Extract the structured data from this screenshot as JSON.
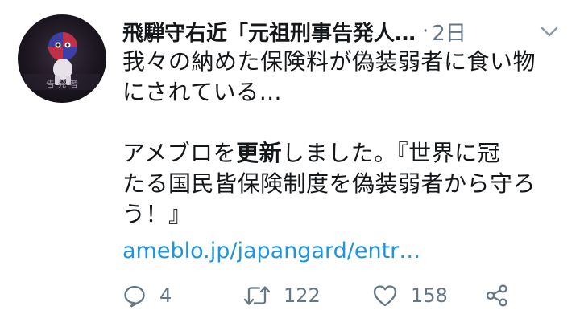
{
  "tweet": {
    "author_name": "飛騨守右近「元祖刑事告発人…",
    "separator": "·",
    "time": "2日",
    "line1": "我々の納めた保険料が偽装弱者に食い物",
    "line2": "にされている…",
    "line3_pre": "アメブロを",
    "line3_bold": "更新",
    "line3_post": "しました。『世界に冠",
    "line4": "たる国民皆保険制度を偽装弱者から守ろ",
    "line5": "う！』",
    "link": "ameblo.jp/japangard/entr…"
  },
  "avatar": {
    "icon": "mascot-avatar",
    "text": "告 発 者"
  },
  "actions": {
    "reply_count": "4",
    "retweet_count": "122",
    "like_count": "158"
  },
  "colors": {
    "text": "#14171a",
    "muted": "#657786",
    "link": "#1b95e0"
  }
}
